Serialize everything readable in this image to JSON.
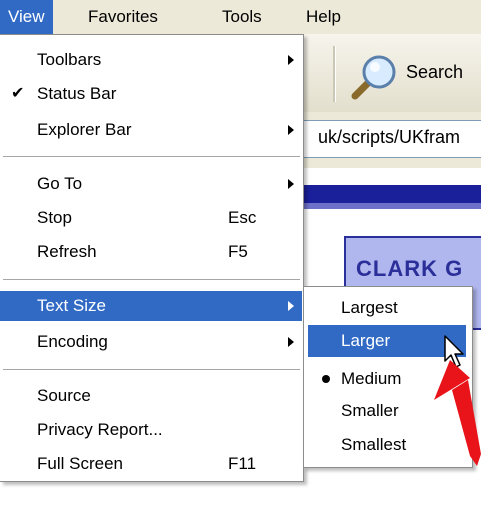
{
  "menubar": {
    "items": [
      {
        "label": "View",
        "active": true
      },
      {
        "label": "Favorites",
        "active": false
      },
      {
        "label": "Tools",
        "active": false
      },
      {
        "label": "Help",
        "active": false
      }
    ]
  },
  "toolbar": {
    "search_label": "Search"
  },
  "address": {
    "text": "uk/scripts/UKfram"
  },
  "page": {
    "box_text": "CLARK G"
  },
  "view_menu": {
    "items": [
      {
        "label": "Toolbars",
        "submenu": true
      },
      {
        "label": "Status Bar",
        "checked": true
      },
      {
        "label": "Explorer Bar",
        "submenu": true
      },
      {
        "label": "Go To",
        "submenu": true
      },
      {
        "label": "Stop",
        "shortcut": "Esc"
      },
      {
        "label": "Refresh",
        "shortcut": "F5"
      },
      {
        "label": "Text Size",
        "submenu": true,
        "highlighted": true
      },
      {
        "label": "Encoding",
        "submenu": true
      },
      {
        "label": "Source"
      },
      {
        "label": "Privacy Report..."
      },
      {
        "label": "Full Screen",
        "shortcut": "F11"
      }
    ]
  },
  "text_size_menu": {
    "items": [
      {
        "label": "Largest"
      },
      {
        "label": "Larger",
        "highlighted": true
      },
      {
        "label": "Medium",
        "selected": true
      },
      {
        "label": "Smaller"
      },
      {
        "label": "Smallest"
      }
    ]
  },
  "colors": {
    "menu_highlight": "#316ac5",
    "menubar_bg": "#ece9d8",
    "annotation_arrow": "#e8141a"
  }
}
